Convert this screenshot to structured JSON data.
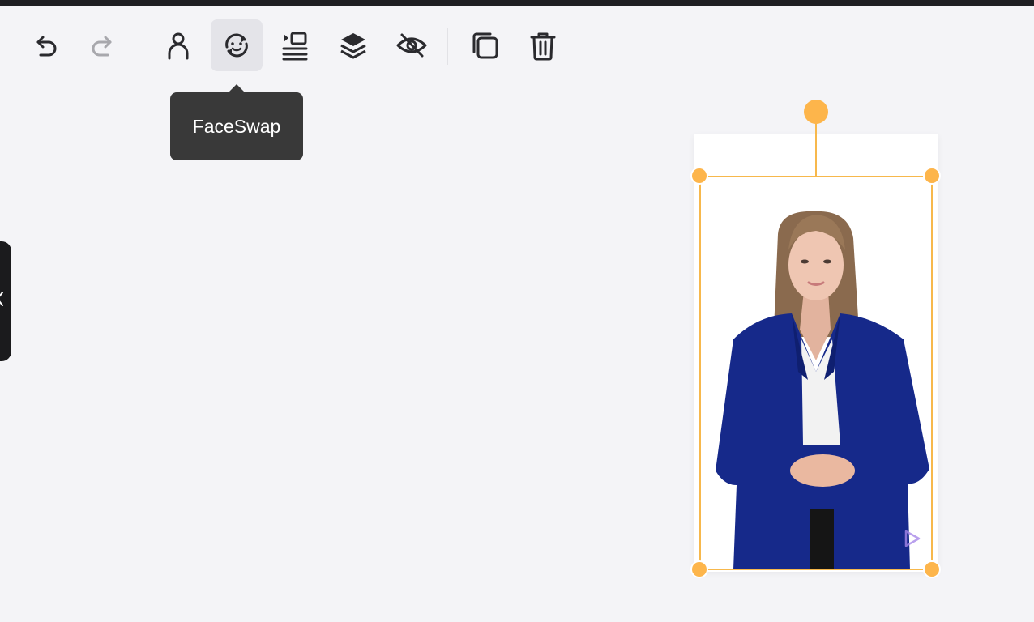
{
  "toolbar": {
    "items": [
      {
        "name": "undo-button",
        "icon": "undo-icon",
        "enabled": true
      },
      {
        "name": "redo-button",
        "icon": "redo-icon",
        "enabled": false
      },
      {
        "name": "avatar-button",
        "icon": "person-icon",
        "enabled": true
      },
      {
        "name": "faceswap-button",
        "icon": "faceswap-icon",
        "enabled": true,
        "active": true
      },
      {
        "name": "align-button",
        "icon": "align-icon",
        "enabled": true
      },
      {
        "name": "layers-button",
        "icon": "layers-icon",
        "enabled": true
      },
      {
        "name": "hide-button",
        "icon": "eye-off-icon",
        "enabled": true
      },
      {
        "name": "duplicate-button",
        "icon": "duplicate-icon",
        "enabled": true
      },
      {
        "name": "delete-button",
        "icon": "trash-icon",
        "enabled": true
      }
    ]
  },
  "tooltip": {
    "text": "FaceSwap"
  },
  "colors": {
    "selection": "#f7b84c",
    "handle": "#fdb54b",
    "icon": "#2a2a2e",
    "icon_disabled": "#a8a8ad",
    "tooltip_bg": "#393939"
  }
}
